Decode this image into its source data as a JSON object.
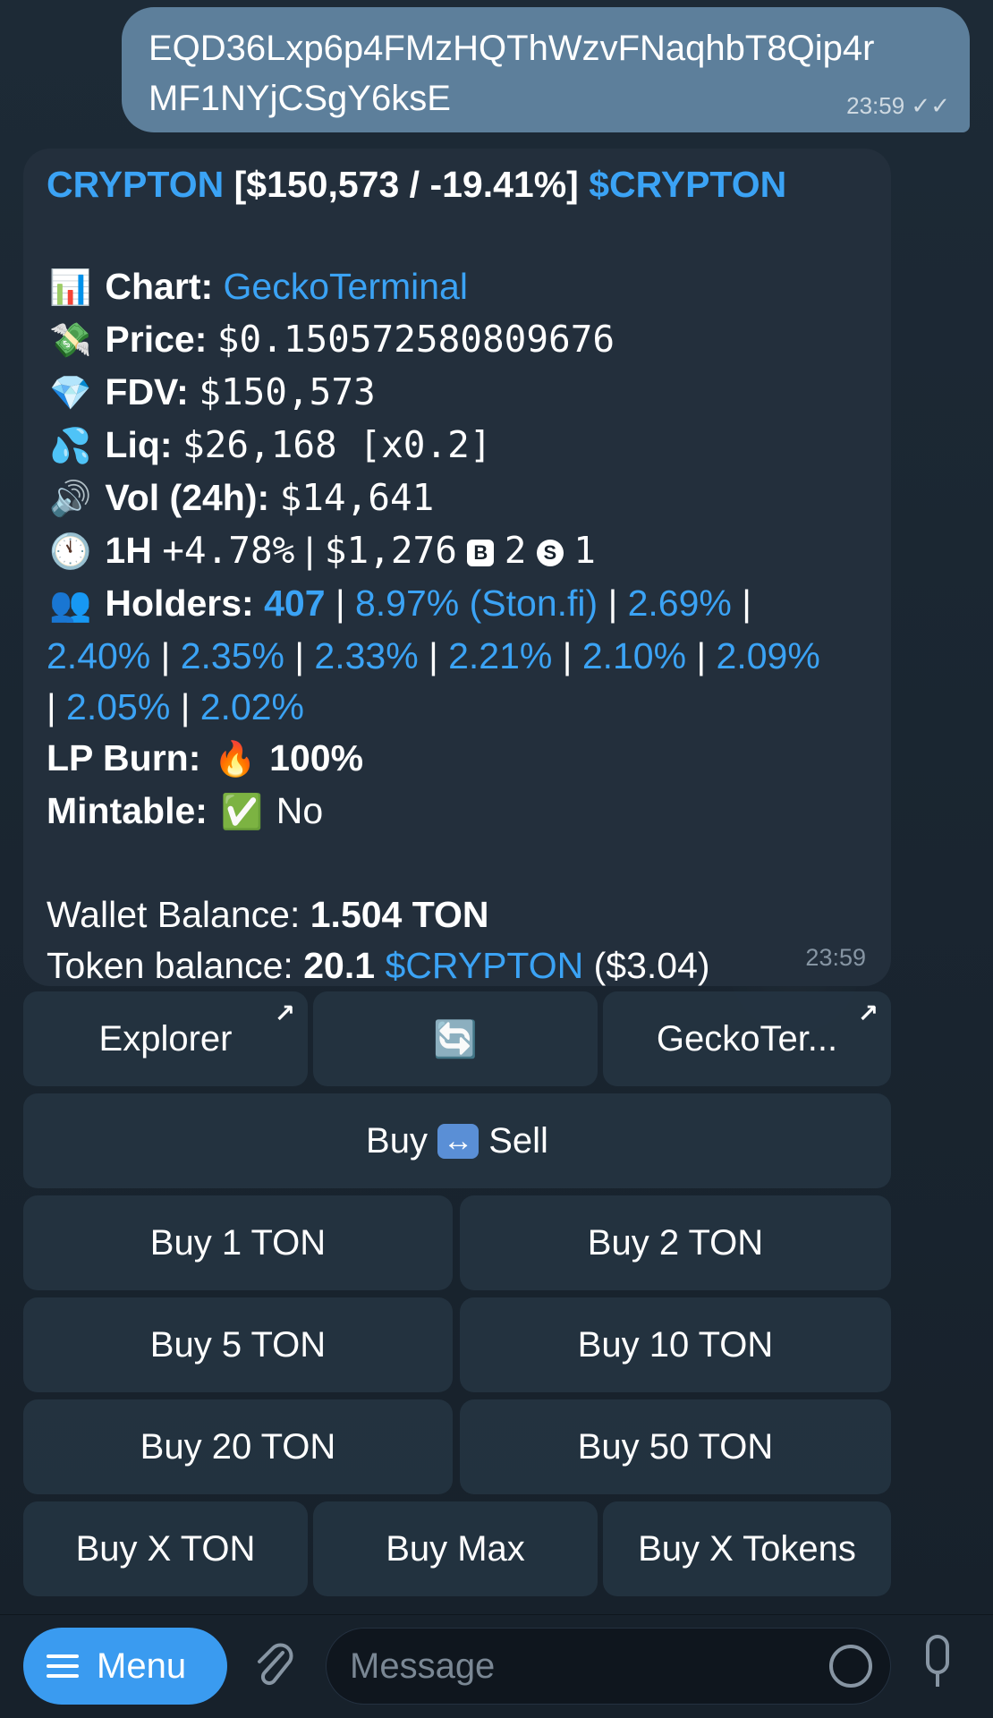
{
  "outgoing": {
    "line1": "EQD36Lxp6p4FMzHQThWzvFNaqhbT8Qip4r",
    "line2": "MF1NYjCSgY6ksE",
    "time": "23:59",
    "ticks": "✓✓"
  },
  "token": {
    "name": "CRYPTON",
    "summary": "[$150,573 / -19.41%]",
    "ticker": "$CRYPTON",
    "chart_label": "Chart:",
    "chart_link": "GeckoTerminal",
    "price_label": "Price:",
    "price": "$0.150572580809676",
    "fdv_label": "FDV:",
    "fdv": "$150,573",
    "liq_label": "Liq:",
    "liq": "$26,168 [x0.2]",
    "vol_label": "Vol (24h):",
    "vol": "$14,641",
    "h1_label": "1H",
    "h1_change": "+4.78%",
    "h1_volume": "$1,276",
    "buys_icon": "B",
    "buys": "2",
    "sells_icon": "S",
    "sells": "1",
    "holders_label": "Holders:",
    "holders_count": "407",
    "holders_top": [
      "8.97% (Ston.fi)",
      "2.69%",
      "2.40%",
      "2.35%",
      "2.33%",
      "2.21%",
      "2.10%",
      "2.09%",
      "2.05%",
      "2.02%"
    ],
    "lp_label": "LP Burn:",
    "lp_value": "100%",
    "mint_label": "Mintable:",
    "mint_value": "No",
    "wallet_label": "Wallet Balance:",
    "wallet_value": "1.504 TON",
    "tb_label": "Token balance:",
    "tb_amount": "20.1",
    "tb_ticker": "$CRYPTON",
    "tb_usd": "($3.04)",
    "time": "23:59"
  },
  "keyboard": {
    "explorer": "Explorer",
    "refresh": "🔄",
    "gecko": "GeckoTer...",
    "ext_arrow": "↗",
    "buy": "Buy",
    "swap": "↔",
    "sell": "Sell",
    "buy1": "Buy 1 TON",
    "buy2": "Buy 2 TON",
    "buy5": "Buy 5 TON",
    "buy10": "Buy 10 TON",
    "buy20": "Buy 20 TON",
    "buy50": "Buy 50 TON",
    "buyx": "Buy X TON",
    "buymax": "Buy Max",
    "buyxtok": "Buy X Tokens"
  },
  "input": {
    "menu": "Menu",
    "placeholder": "Message"
  },
  "icons": {
    "chart": "📊",
    "price": "💸",
    "fdv": "💎",
    "liq": "💦",
    "vol": "🔊",
    "clock": "🕚",
    "holders": "👥",
    "fire": "🔥",
    "check": "✅",
    "attach": "📎"
  },
  "colors": {
    "background": "#17212b",
    "outgoing_bubble": "#5d7f9b",
    "incoming_bubble": "#232f3c",
    "link": "#3ba3f5",
    "menu_button": "#3a9bf0"
  }
}
